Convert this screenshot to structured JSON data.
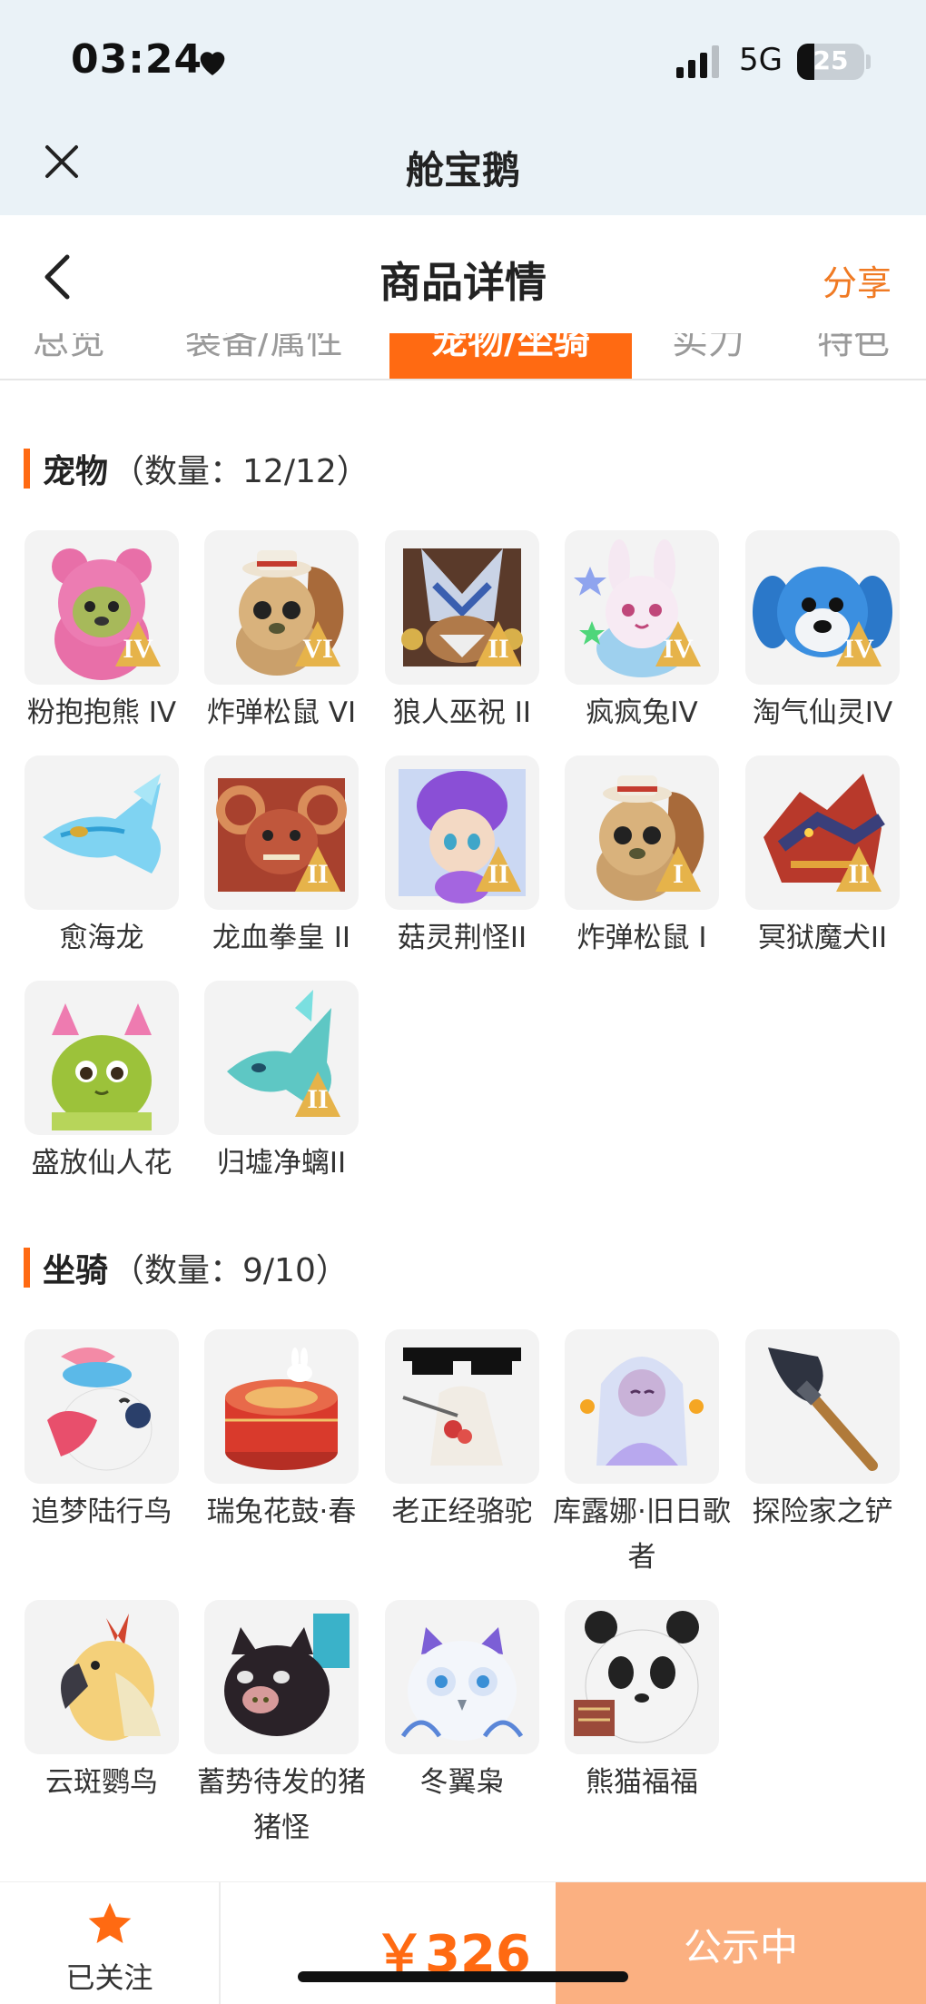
{
  "status_bar": {
    "time": "03:24",
    "network": "5G",
    "battery": "25",
    "battery_level": 0.25
  },
  "mini_program": {
    "title": "舱宝鹅"
  },
  "nav": {
    "title": "商品详情",
    "share_label": "分享"
  },
  "tabs": [
    "总览",
    "装备/属性",
    "宠物/坐骑",
    "实力",
    "特色"
  ],
  "pets": {
    "title": "宠物",
    "count": "（数量：12/12）",
    "items": [
      {
        "name": "粉抱抱熊 IV",
        "grade": "IV",
        "icon": "pink-bear"
      },
      {
        "name": "炸弹松鼠 VI",
        "grade": "VI",
        "icon": "squirrel"
      },
      {
        "name": "狼人巫祝 II",
        "grade": "II",
        "icon": "werewolf"
      },
      {
        "name": "疯疯兔IV",
        "grade": "IV",
        "icon": "rabbit"
      },
      {
        "name": "淘气仙灵IV",
        "grade": "IV",
        "icon": "blue-puppy"
      },
      {
        "name": "愈海龙",
        "grade": "",
        "icon": "sea-dragon"
      },
      {
        "name": "龙血拳皇 II",
        "grade": "II",
        "icon": "dragon-boxer"
      },
      {
        "name": "菇灵荆怪II",
        "grade": "II",
        "icon": "mushroom-sprite"
      },
      {
        "name": "炸弹松鼠 I",
        "grade": "I",
        "icon": "squirrel"
      },
      {
        "name": "冥狱魔犬II",
        "grade": "II",
        "icon": "hell-hound"
      },
      {
        "name": "盛放仙人花",
        "grade": "",
        "icon": "cactus-flower"
      },
      {
        "name": "归墟净螭II",
        "grade": "II",
        "icon": "cyan-dragon"
      }
    ]
  },
  "mounts": {
    "title": "坐骑",
    "count": "（数量：9/10）",
    "items": [
      {
        "name": "追梦陆行鸟",
        "icon": "bird"
      },
      {
        "name": "瑞兔花鼓·春",
        "icon": "drum"
      },
      {
        "name": "老正经骆驼",
        "icon": "camel"
      },
      {
        "name": "库露娜·旧日歌者",
        "icon": "mermaid"
      },
      {
        "name": "探险家之铲",
        "icon": "shovel"
      },
      {
        "name": "云斑鹦鸟",
        "icon": "parrot"
      },
      {
        "name": "蓄势待发的猪猪怪",
        "icon": "pig"
      },
      {
        "name": "冬翼枭",
        "icon": "owl"
      },
      {
        "name": "熊猫福福",
        "icon": "panda"
      }
    ]
  },
  "bottom": {
    "follow_label": "已关注",
    "price": "￥326",
    "status_label": "公示中"
  },
  "colors": {
    "accent": "#ff6a12",
    "status_button": "#fbb081",
    "share": "#f07a23"
  }
}
